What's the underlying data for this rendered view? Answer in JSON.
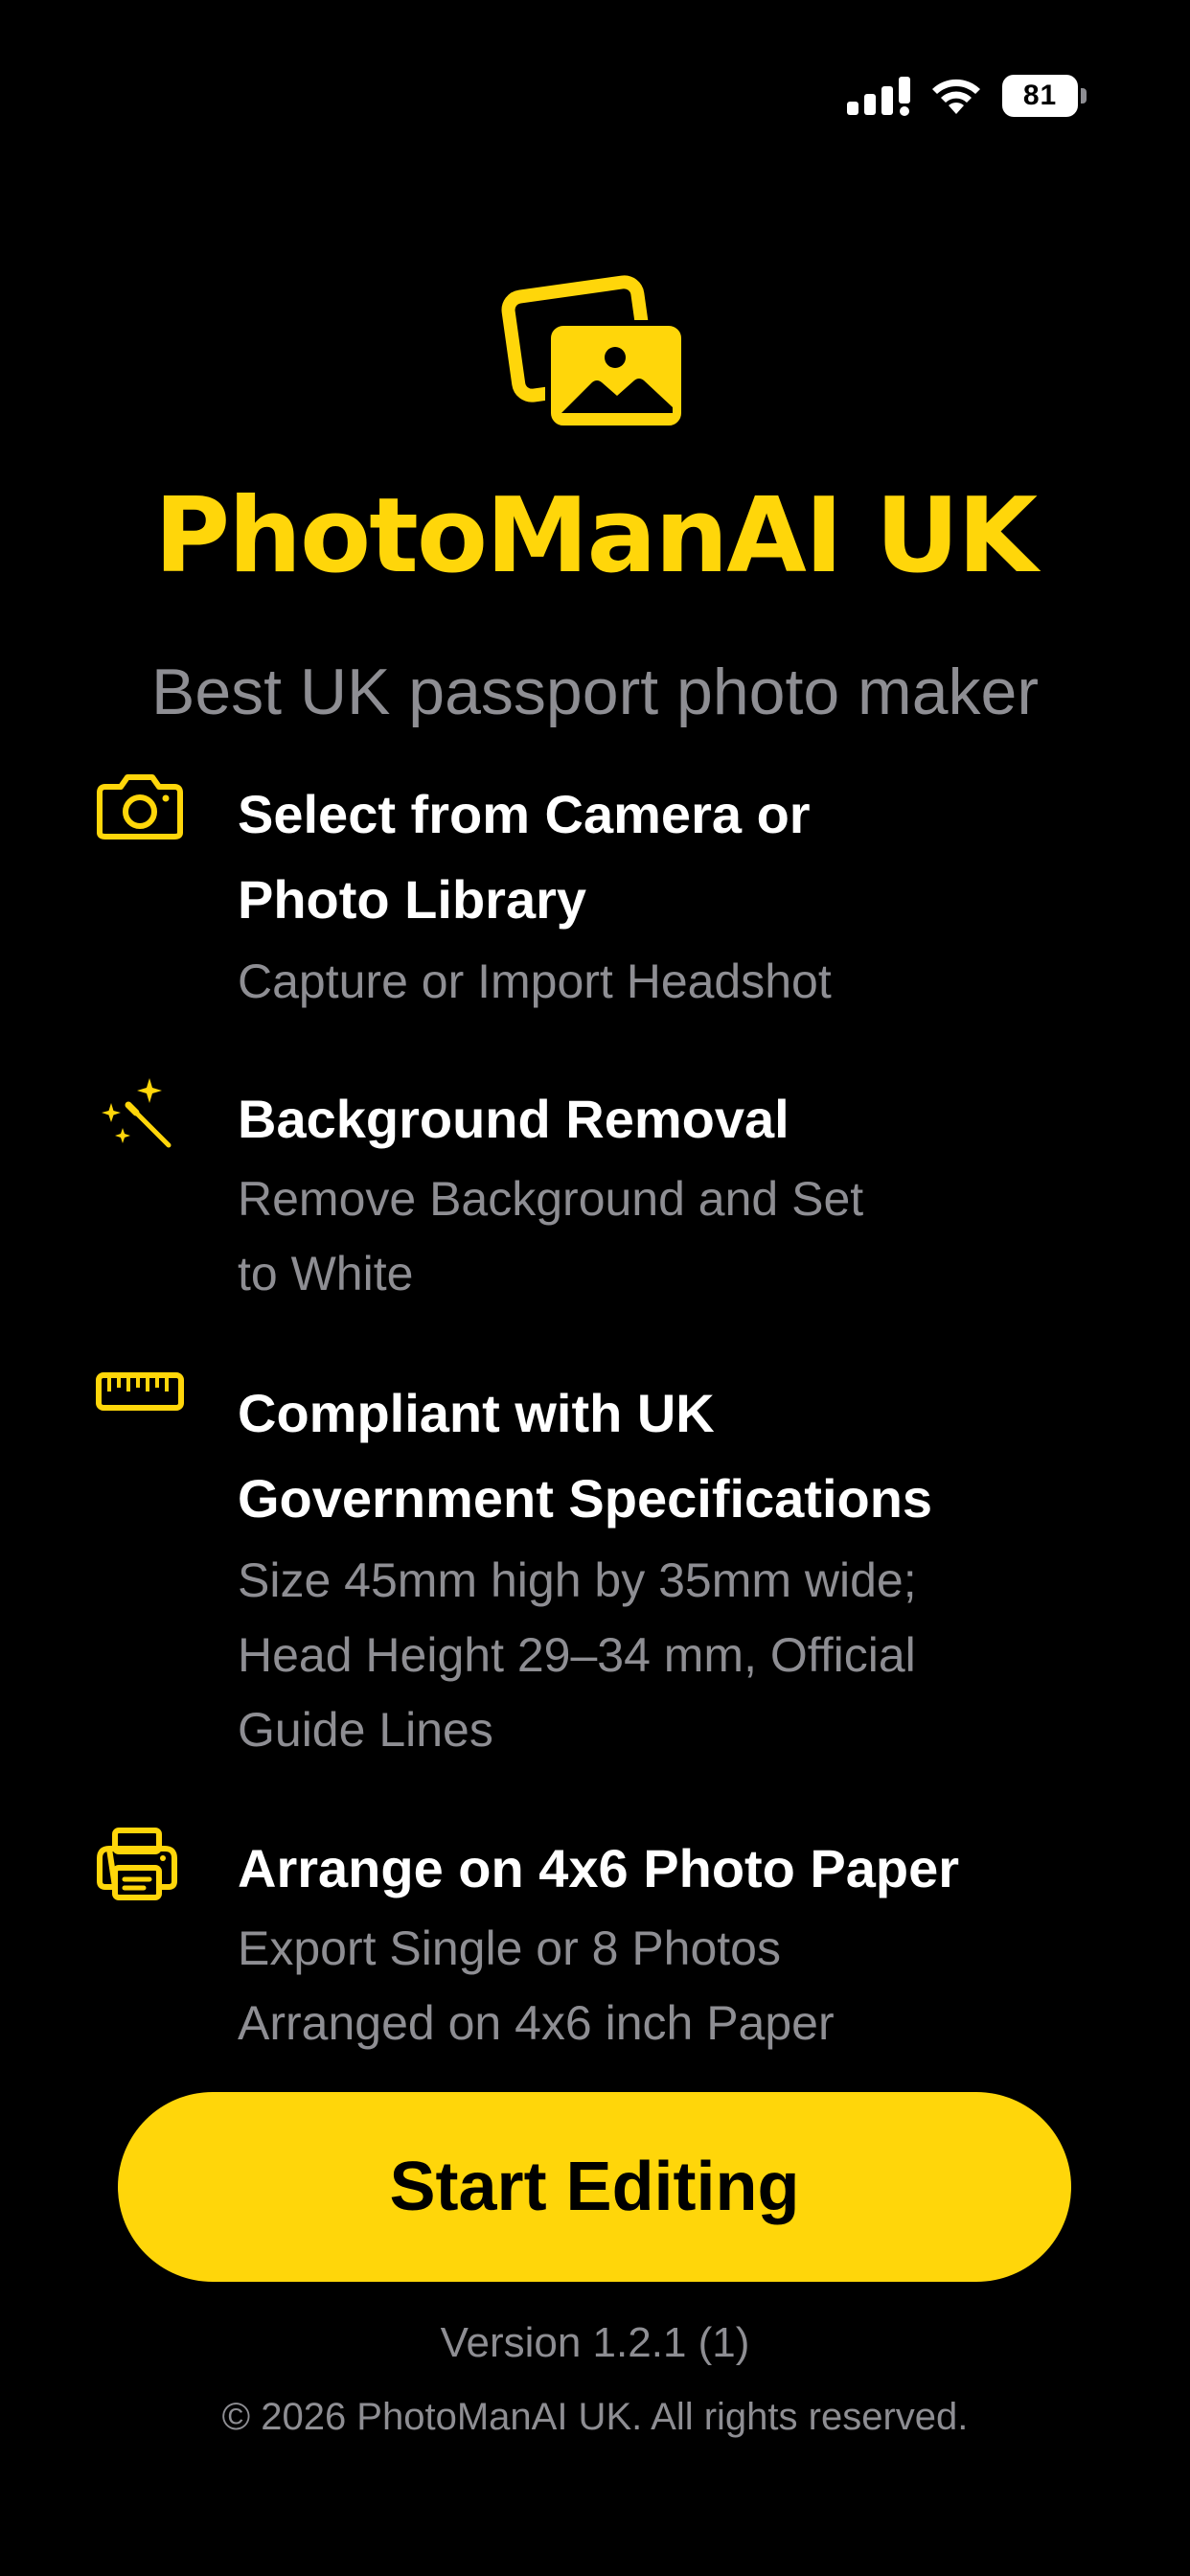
{
  "status_bar": {
    "battery_level": "81",
    "icons": [
      "cellular-signal-icon",
      "wifi-icon",
      "battery-icon"
    ]
  },
  "header": {
    "logo_icon": "photos-icon",
    "title": "PhotoManAI UK",
    "subtitle": "Best UK passport photo maker"
  },
  "features": [
    {
      "icon": "camera-icon",
      "title_lines": [
        "Select from Camera or",
        "Photo Library"
      ],
      "desc_lines": [
        "Capture or Import Headshot"
      ]
    },
    {
      "icon": "magic-wand-icon",
      "title_lines": [
        "Background Removal"
      ],
      "desc_lines": [
        "Remove Background and Set",
        "to White"
      ]
    },
    {
      "icon": "ruler-icon",
      "title_lines": [
        "Compliant with UK",
        "Government Specifications"
      ],
      "desc_lines": [
        "Size 45mm high by 35mm wide;",
        "Head Height 29–34 mm, Official",
        "Guide Lines"
      ]
    },
    {
      "icon": "printer-icon",
      "title_lines": [
        "Arrange on 4x6 Photo Paper"
      ],
      "desc_lines": [
        "Export Single or 8 Photos",
        "Arranged on 4x6 inch Paper"
      ]
    }
  ],
  "cta": {
    "label": "Start Editing"
  },
  "footer": {
    "version": "Version 1.2.1 (1)",
    "copyright": "© 2026 PhotoManAI UK. All rights reserved."
  },
  "colors": {
    "accent": "#FFD60A",
    "background": "#000000",
    "primary_text": "#FFFFFF",
    "secondary_text": "#8E8E93"
  }
}
